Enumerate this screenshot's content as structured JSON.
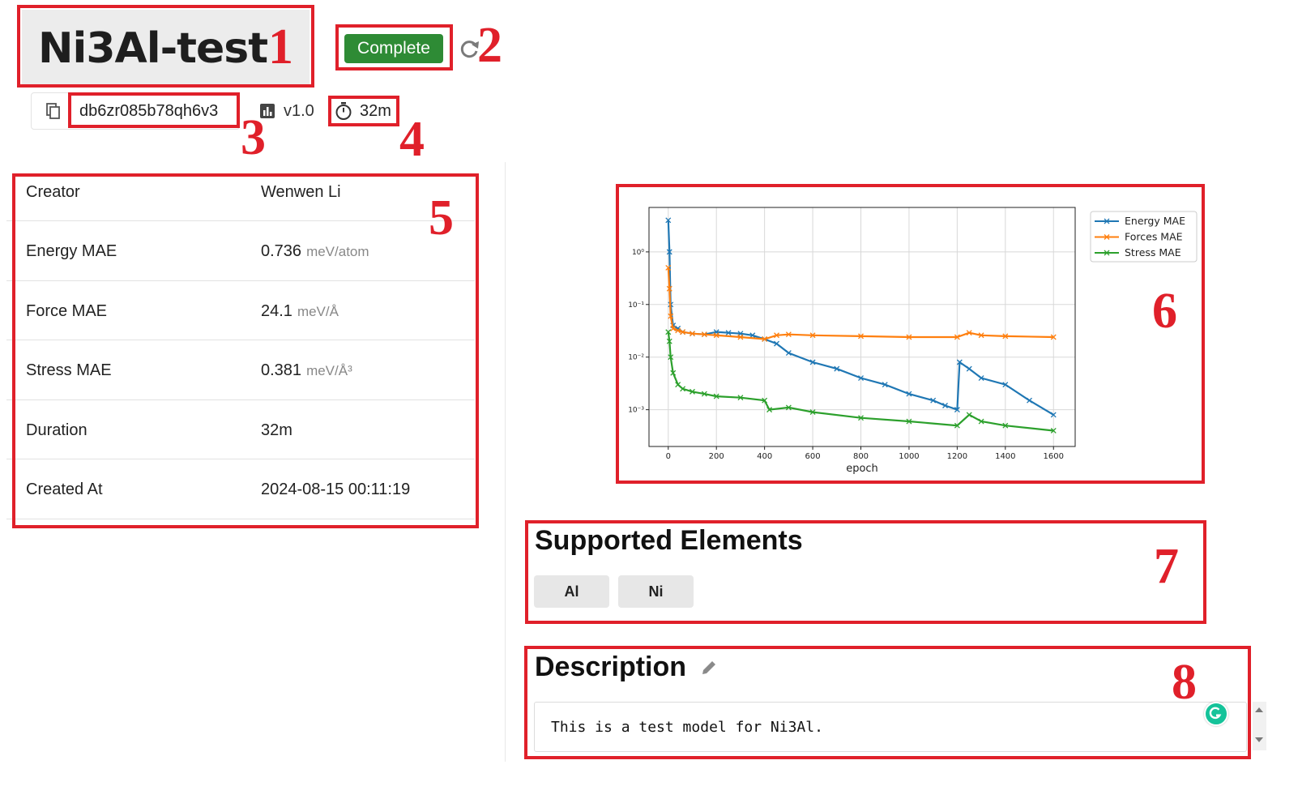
{
  "header": {
    "title": "Ni3Al-test",
    "status_label": "Complete",
    "id": "db6zr085b78qh6v3",
    "version": "v1.0",
    "duration": "32m"
  },
  "annotations": [
    "1",
    "2",
    "3",
    "4",
    "5",
    "6",
    "7",
    "8"
  ],
  "info": {
    "rows": [
      {
        "label": "Creator",
        "value": "Wenwen Li",
        "unit": ""
      },
      {
        "label": "Energy MAE",
        "value": "0.736",
        "unit": "meV/atom"
      },
      {
        "label": "Force MAE",
        "value": "24.1",
        "unit": "meV/Å"
      },
      {
        "label": "Stress MAE",
        "value": "0.381",
        "unit": "meV/Å³"
      },
      {
        "label": "Duration",
        "value": "32m",
        "unit": ""
      },
      {
        "label": "Created At",
        "value": "2024-08-15 00:11:19",
        "unit": ""
      }
    ]
  },
  "chart_data": {
    "type": "line",
    "title": "",
    "xlabel": "epoch",
    "ylabel": "",
    "xlim": [
      -80,
      1690
    ],
    "ylim": [
      0.0002,
      7
    ],
    "yscale": "log",
    "x_ticks": [
      0,
      200,
      400,
      600,
      800,
      1000,
      1200,
      1400,
      1600
    ],
    "y_ticks": [
      {
        "value": 1,
        "label": "10⁰"
      },
      {
        "value": 0.1,
        "label": "10⁻¹"
      },
      {
        "value": 0.01,
        "label": "10⁻²"
      },
      {
        "value": 0.001,
        "label": "10⁻³"
      }
    ],
    "grid": true,
    "legend": "top-right",
    "marker": "x",
    "series": [
      {
        "name": "Energy MAE",
        "color": "#1f77b4",
        "x": [
          0,
          5,
          10,
          20,
          40,
          60,
          100,
          150,
          200,
          250,
          300,
          350,
          400,
          450,
          500,
          600,
          700,
          800,
          900,
          1000,
          1100,
          1150,
          1200,
          1210,
          1250,
          1300,
          1400,
          1500,
          1600
        ],
        "y": [
          4.0,
          1.0,
          0.1,
          0.04,
          0.035,
          0.03,
          0.028,
          0.027,
          0.03,
          0.029,
          0.028,
          0.026,
          0.022,
          0.018,
          0.012,
          0.008,
          0.006,
          0.004,
          0.003,
          0.002,
          0.0015,
          0.0012,
          0.001,
          0.008,
          0.006,
          0.004,
          0.003,
          0.0015,
          0.0008
        ]
      },
      {
        "name": "Forces MAE",
        "color": "#ff7f0e",
        "x": [
          0,
          5,
          10,
          20,
          40,
          60,
          100,
          150,
          200,
          300,
          400,
          450,
          500,
          600,
          800,
          1000,
          1200,
          1250,
          1300,
          1400,
          1600
        ],
        "y": [
          0.5,
          0.2,
          0.06,
          0.035,
          0.032,
          0.03,
          0.028,
          0.027,
          0.026,
          0.024,
          0.022,
          0.026,
          0.027,
          0.026,
          0.025,
          0.024,
          0.024,
          0.029,
          0.026,
          0.025,
          0.024
        ]
      },
      {
        "name": "Stress MAE",
        "color": "#2ca02c",
        "x": [
          0,
          5,
          10,
          20,
          40,
          60,
          100,
          150,
          200,
          300,
          400,
          420,
          500,
          600,
          800,
          1000,
          1200,
          1250,
          1300,
          1400,
          1600
        ],
        "y": [
          0.03,
          0.02,
          0.01,
          0.005,
          0.003,
          0.0025,
          0.0022,
          0.002,
          0.0018,
          0.0017,
          0.0015,
          0.001,
          0.0011,
          0.0009,
          0.0007,
          0.0006,
          0.0005,
          0.0008,
          0.0006,
          0.0005,
          0.0004
        ]
      }
    ]
  },
  "supported_elements": {
    "title": "Supported Elements",
    "items": [
      "Al",
      "Ni"
    ]
  },
  "description": {
    "title": "Description",
    "text": "This is a test model for Ni3Al."
  },
  "icons": {
    "refresh": "refresh-icon",
    "copy": "copy-icon",
    "version": "bar-chart-icon",
    "duration": "timer-icon",
    "edit": "pencil-icon",
    "grammarly": "grammarly-icon"
  },
  "colors": {
    "status": "#2e8b35",
    "annotation": "#e0202a",
    "title_chip": "#ececec"
  }
}
